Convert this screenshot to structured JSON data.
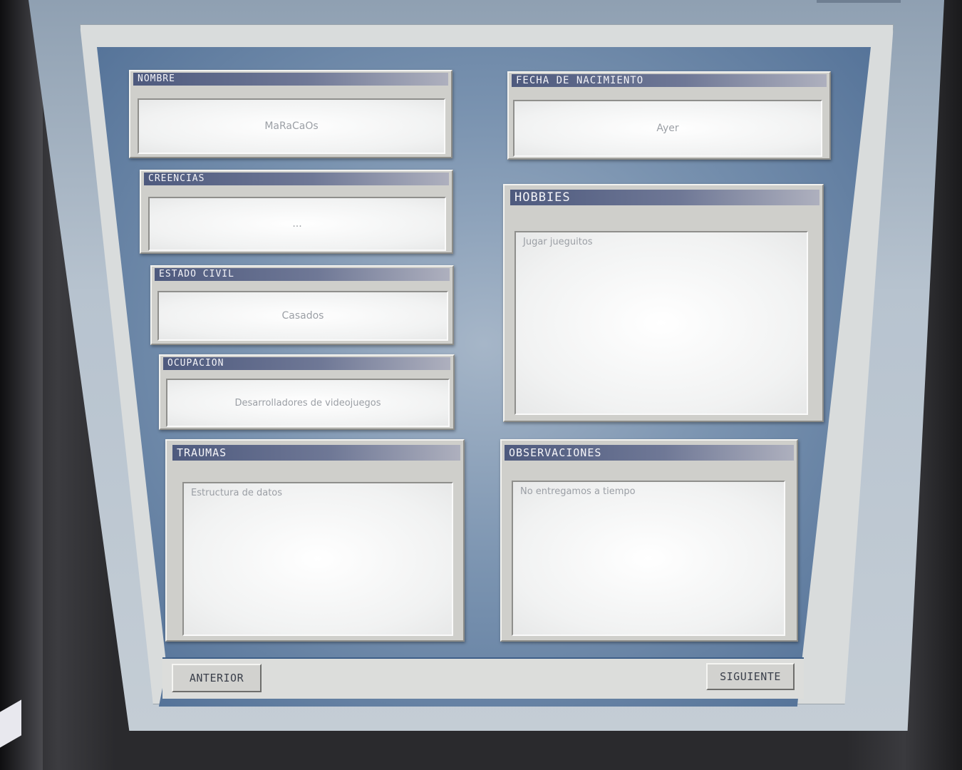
{
  "form": {
    "nombre": {
      "label": "NOMBRE",
      "value": "MaRaCaOs"
    },
    "fecha": {
      "label": "FECHA DE NACIMIENTO",
      "value": "Ayer"
    },
    "creencias": {
      "label": "CREENCIAS",
      "value": "..."
    },
    "hobbies": {
      "label": "HOBBIES",
      "value": "Jugar jueguitos"
    },
    "estado_civil": {
      "label": "ESTADO CIVIL",
      "value": "Casados"
    },
    "ocupacion": {
      "label": "OCUPACION",
      "value": "Desarrolladores de videojuegos"
    },
    "traumas": {
      "label": "TRAUMAS",
      "value": "Estructura de datos"
    },
    "observaciones": {
      "label": "OBSERVACIONES",
      "value": "No entregamos a tiempo"
    }
  },
  "nav": {
    "prev_label": "ANTERIOR",
    "next_label": "SIGUIENTE"
  },
  "colors": {
    "panel_bg": "#4f6e95",
    "title_bar": "#4e5a7e",
    "field_text": "#9b9fa5"
  }
}
